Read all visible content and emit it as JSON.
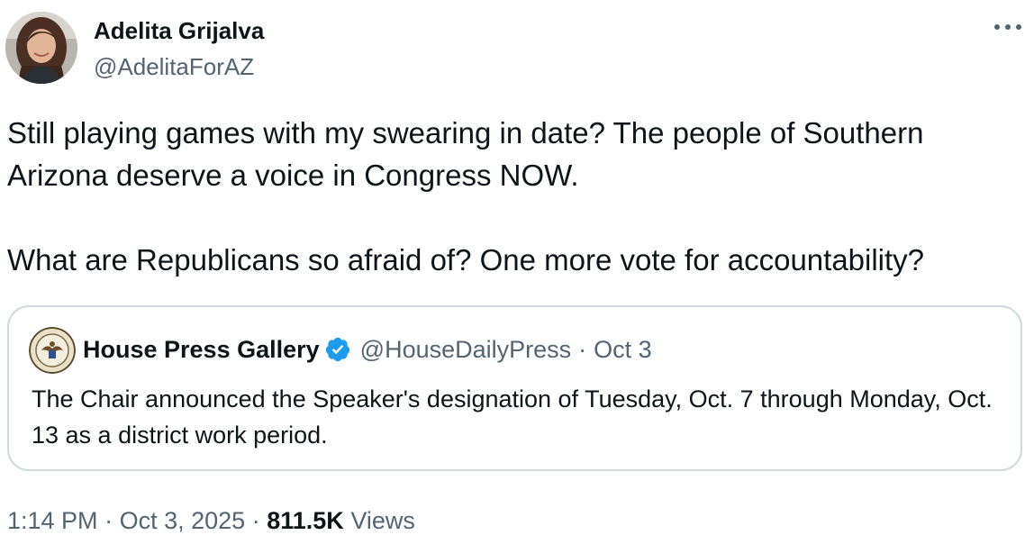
{
  "author": {
    "name": "Adelita Grijalva",
    "handle": "@AdelitaForAZ"
  },
  "tweet": {
    "paragraphs": [
      "Still playing games with my swearing in date? The people of Southern Arizona deserve a voice in Congress NOW.",
      "What are Republicans so afraid of? One more vote for accountability?"
    ]
  },
  "quote": {
    "name": "House Press Gallery",
    "handle": "@HouseDailyPress",
    "separator": "·",
    "date": "Oct 3",
    "text": "The Chair announced the Speaker's designation of Tuesday, Oct. 7 through Monday, Oct. 13 as a district work period."
  },
  "meta": {
    "time": "1:14 PM",
    "separator": "·",
    "date": "Oct 3, 2025",
    "views_count": "811.5K",
    "views_label": "Views"
  },
  "icons": {
    "more": "more-horizontal-icon",
    "verified": "verified-badge-icon"
  },
  "colors": {
    "text_primary": "#0f1419",
    "text_secondary": "#536471",
    "border": "#cfd9de",
    "verified_blue": "#1d9bf0"
  }
}
